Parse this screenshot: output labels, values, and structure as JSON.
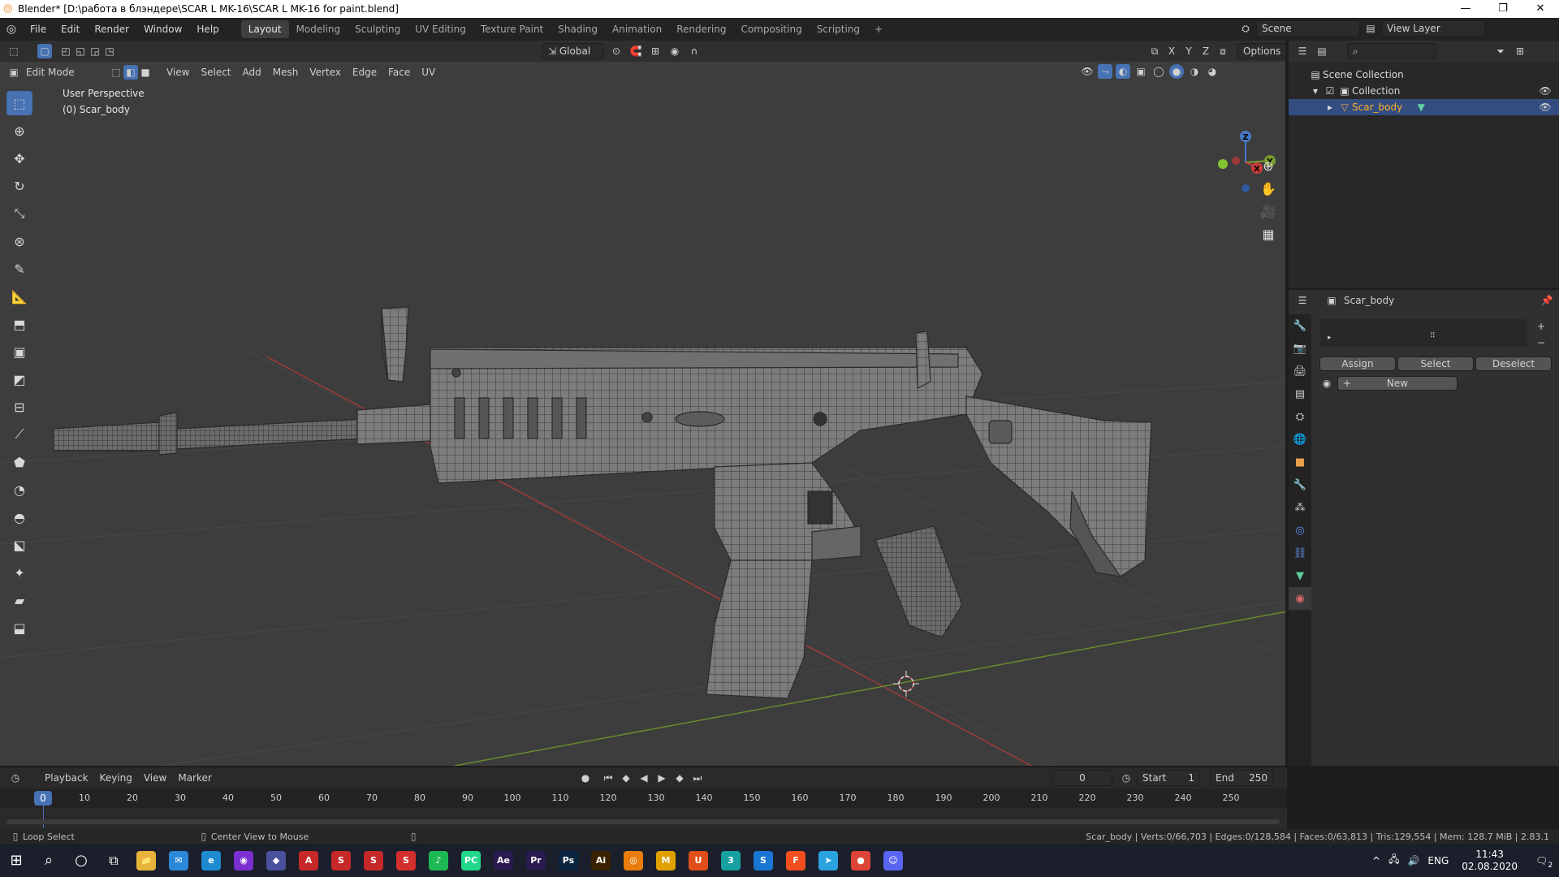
{
  "window": {
    "title": "Blender* [D:\\работа в блэндере\\SCAR L MK-16\\SCAR L MK-16 for paint.blend]",
    "minimize": "—",
    "restore": "❐",
    "close": "✕"
  },
  "menu": [
    "File",
    "Edit",
    "Render",
    "Window",
    "Help"
  ],
  "workspaces": [
    "Layout",
    "Modeling",
    "Sculpting",
    "UV Editing",
    "Texture Paint",
    "Shading",
    "Animation",
    "Rendering",
    "Compositing",
    "Scripting"
  ],
  "workspace_add": "+",
  "scene": {
    "label": "Scene",
    "view_layer": "View Layer"
  },
  "viewport": {
    "mode": "Edit Mode",
    "header_menus": [
      "View",
      "Select",
      "Add",
      "Mesh",
      "Vertex",
      "Edge",
      "Face",
      "UV"
    ],
    "orientation": "Global",
    "options": "Options",
    "axes": [
      "X",
      "Y",
      "Z"
    ],
    "info_line1": "User Perspective",
    "info_line2": "(0) Scar_body",
    "gizmo": {
      "z": "Z",
      "y": "Y",
      "x": "X"
    }
  },
  "outliner": {
    "scene_collection": "Scene Collection",
    "collection": "Collection",
    "object": "Scar_body"
  },
  "properties": {
    "object_name": "Scar_body",
    "assign": "Assign",
    "select": "Select",
    "deselect": "Deselect",
    "new": "New"
  },
  "timeline": {
    "menus": [
      "Playback",
      "Keying",
      "View",
      "Marker"
    ],
    "current_frame": "0",
    "start_label": "Start",
    "start_value": "1",
    "end_label": "End",
    "end_value": "250",
    "ruler": [
      "0",
      "10",
      "20",
      "30",
      "40",
      "50",
      "60",
      "70",
      "80",
      "90",
      "100",
      "110",
      "120",
      "130",
      "140",
      "150",
      "160",
      "170",
      "180",
      "190",
      "200",
      "210",
      "220",
      "230",
      "240",
      "250"
    ]
  },
  "status": {
    "left": "Loop Select",
    "middle": "Center View to Mouse",
    "right": "Scar_body | Verts:0/66,703 | Edges:0/128,584 | Faces:0/63,813 | Tris:129,554 | Mem: 128.7 MiB | 2.83.1"
  },
  "taskbar": {
    "apps": [
      {
        "icon": "file-explorer-icon",
        "label": "📁",
        "color": "#e8b339"
      },
      {
        "icon": "mail-icon",
        "label": "✉",
        "color": "#2b88d8"
      },
      {
        "icon": "edge-icon",
        "label": "e",
        "color": "#1e8bd1"
      },
      {
        "icon": "podcast-icon",
        "label": "◉",
        "color": "#7b2fd1"
      },
      {
        "icon": "app-icon",
        "label": "◆",
        "color": "#4a4f9e"
      },
      {
        "icon": "app-red-icon",
        "label": "A",
        "color": "#c62828"
      },
      {
        "icon": "sketchup-icon",
        "label": "S",
        "color": "#c62828"
      },
      {
        "icon": "substance-icon",
        "label": "S",
        "color": "#c62828"
      },
      {
        "icon": "substance-painter-icon",
        "label": "S",
        "color": "#d32f2f"
      },
      {
        "icon": "spotify-icon",
        "label": "♪",
        "color": "#1db954"
      },
      {
        "icon": "pycharm-icon",
        "label": "PC",
        "color": "#21d789"
      },
      {
        "icon": "after-effects-icon",
        "label": "Ae",
        "color": "#2a1a4e"
      },
      {
        "icon": "premiere-icon",
        "label": "Pr",
        "color": "#2a1a4e"
      },
      {
        "icon": "photoshop-icon",
        "label": "Ps",
        "color": "#0b2540"
      },
      {
        "icon": "illustrator-icon",
        "label": "Ai",
        "color": "#3a2200"
      },
      {
        "icon": "blender-icon",
        "label": "◎",
        "color": "#e87d0d"
      },
      {
        "icon": "marmoset-icon",
        "label": "M",
        "color": "#e0a100"
      },
      {
        "icon": "app-orange-icon",
        "label": "U",
        "color": "#e04f1a"
      },
      {
        "icon": "3dsmax-icon",
        "label": "3",
        "color": "#16a0a0"
      },
      {
        "icon": "app-blue-icon",
        "label": "S",
        "color": "#1976d2"
      },
      {
        "icon": "figma-icon",
        "label": "F",
        "color": "#f24e1e"
      },
      {
        "icon": "telegram-icon",
        "label": "➤",
        "color": "#2aa3df"
      },
      {
        "icon": "chrome-icon",
        "label": "●",
        "color": "#db4437"
      },
      {
        "icon": "discord-icon",
        "label": "☺",
        "color": "#5865f2"
      }
    ],
    "lang": "ENG",
    "time": "11:43",
    "date": "02.08.2020",
    "notifications": "2"
  }
}
